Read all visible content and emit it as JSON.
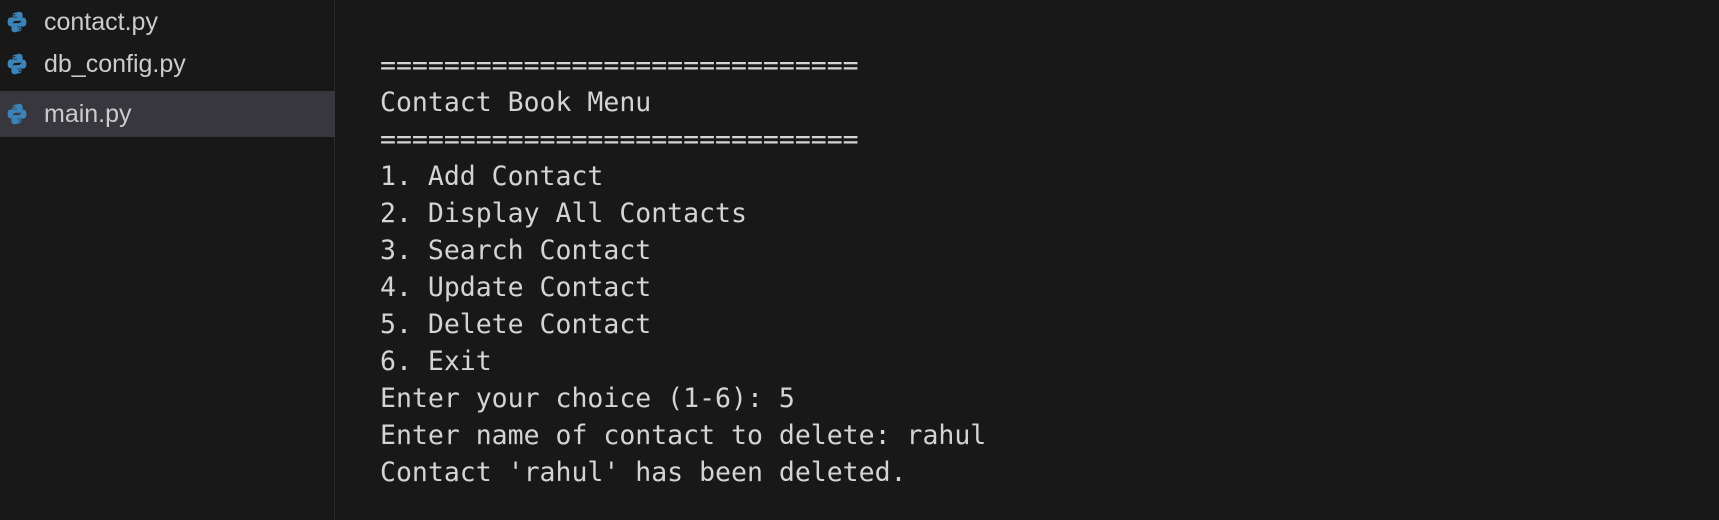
{
  "explorer": {
    "files": [
      {
        "name": "contact.py",
        "icon": "python-file-icon",
        "selected": false
      },
      {
        "name": "db_config.py",
        "icon": "python-file-icon",
        "selected": false
      },
      {
        "name": "main.py",
        "icon": "python-file-icon",
        "selected": true
      }
    ]
  },
  "terminal": {
    "lines": [
      "==============================",
      "Contact Book Menu",
      "==============================",
      "1. Add Contact",
      "2. Display All Contacts",
      "3. Search Contact",
      "4. Update Contact",
      "5. Delete Contact",
      "6. Exit",
      "Enter your choice (1-6): 5",
      "Enter name of contact to delete: rahul",
      "Contact 'rahul' has been deleted."
    ]
  },
  "colors": {
    "background": "#181818",
    "selected_row": "#37373d",
    "text": "#cccccc",
    "python_blue": "#3c83b8",
    "python_yellow": "#f5c940"
  }
}
